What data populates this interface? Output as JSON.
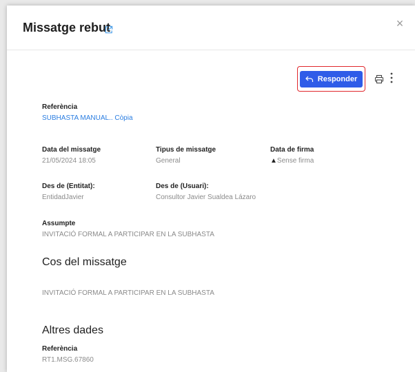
{
  "header": {
    "title": "Missatge rebut",
    "external_icon": "external-link-icon",
    "close_label": "×"
  },
  "toolbar": {
    "reply_label": "Responder",
    "reply_icon": "reply-icon",
    "print_icon": "printer-icon",
    "more_icon": "more-vertical-icon",
    "accent_color": "#2f5ce8",
    "highlight_color": "#e0262b"
  },
  "fields": {
    "referencia": {
      "label": "Referència",
      "value": "SUBHASTA MANUAL.. Còpia"
    },
    "data_missatge": {
      "label": "Data del missatge",
      "value": "21/05/2024 18:05"
    },
    "tipus_missatge": {
      "label": "Tipus de missatge",
      "value": "General"
    },
    "data_firma": {
      "label": "Data de firma",
      "value": "Sense firma",
      "icon": "warning-icon"
    },
    "des_entitat": {
      "label": "Des de (Entitat):",
      "value": "EntidadJavier"
    },
    "des_usuari": {
      "label": "Des de (Usuari):",
      "value": "Consultor Javier Sualdea Lázaro"
    },
    "assumpte": {
      "label": "Assumpte",
      "value": "INVITACIÓ FORMAL A PARTICIPAR EN LA SUBHASTA"
    }
  },
  "cos": {
    "heading": "Cos del missatge",
    "text": "INVITACIÓ FORMAL A PARTICIPAR EN LA SUBHASTA"
  },
  "altres": {
    "heading": "Altres dades",
    "ref_label": "Referència",
    "ref_value": "RT1.MSG.67860"
  }
}
